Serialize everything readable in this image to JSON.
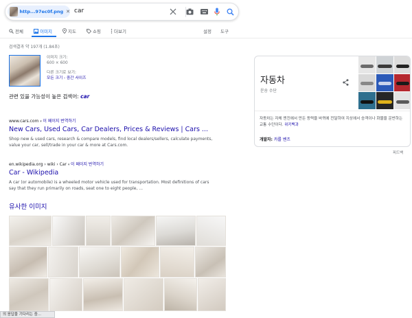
{
  "search": {
    "chip_label": "http...97ec0f.png",
    "query": "car"
  },
  "tabs": [
    {
      "label": "전체",
      "icon": "search-icon"
    },
    {
      "label": "이미지",
      "icon": "image-icon"
    },
    {
      "label": "지도",
      "icon": "map-pin-icon"
    },
    {
      "label": "쇼핑",
      "icon": "tag-icon"
    },
    {
      "label": "더보기",
      "icon": "more-vert-icon"
    }
  ],
  "tools": {
    "settings": "설정",
    "tools": "도구"
  },
  "stats": "검색결과 약 197개 (1.84초)",
  "image_info": {
    "size_label": "이미지 크기:",
    "size_value": "600 × 600",
    "other_sizes": "다른 크기로 보기:",
    "other_sizes_link": "모든 크기 - 중간 사이즈"
  },
  "related": {
    "prefix": "관련 있을 가능성이 높은 검색어:",
    "term": "car"
  },
  "results": [
    {
      "url": "www.cars.com",
      "translate": "이 페이지 번역하기",
      "title": "New Cars, Used Cars, Car Dealers, Prices & Reviews | Cars ...",
      "snippet": "Shop new & used cars, research & compare models, find local dealers/sellers, calculate payments, value your car, sell/trade in your car & more at Cars.com."
    },
    {
      "url": "en.wikipedia.org › wiki › Car",
      "translate": "이 페이지 번역하기",
      "title": "Car - Wikipedia",
      "snippet": "A car (or automobile) is a wheeled motor vehicle used for transportation. Most definitions of cars say that they run primarily on roads, seat one to eight people, ..."
    }
  ],
  "similar_title": "유사한 이미지",
  "knowledge_panel": {
    "title": "자동차",
    "subtitle": "운송 수단",
    "description": "자동차는 자체 엔진에서 만든 동력을 바퀴에 전달하여 지상에서 승객이나 화물을 운반하는 교통 수단이다.",
    "description_link": "위키백과",
    "developer_label": "개발자:",
    "developer_value": "카를 벤츠"
  },
  "feedback": "피드백",
  "status": "의 응답을 기다리는 중...",
  "colors": {
    "accent": "#1a73e8",
    "link": "#1a0dab"
  }
}
